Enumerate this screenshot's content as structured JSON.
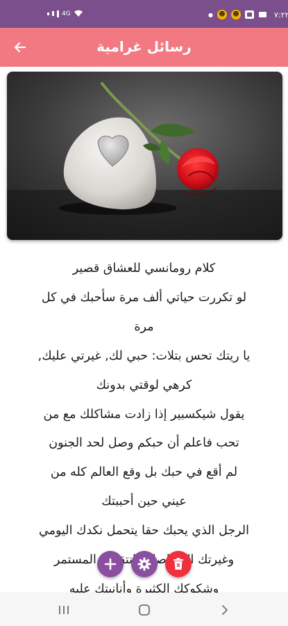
{
  "status_bar": {
    "time": "٧:٢٢",
    "network": "4G"
  },
  "app_bar": {
    "title": "رسائل غرامية",
    "back_icon": "arrow-back-icon"
  },
  "hero": {
    "image": "heart-stone-and-red-rose-photo"
  },
  "article": {
    "lines": [
      "كلام رومانسي للعشاق قصير",
      "لو تكررت حياتي ألف مرة سأحبك في كل",
      "مرة",
      "يا ريتك تحس بتلات: حبي لك, غيرتي عليك,",
      "كرهي لوقتي بدونك",
      "يقول شيكسبير إذا زادت مشاكلك مع من",
      "تحب فاعلم أن حبكم وصل لحد الجنون",
      "لم أقع في حبك بل وقع العالم كله من",
      "عيني حين أحببتك",
      "الرجل الذي يحبك حقا يتحمل نكدك اليومي",
      "وغيرتك المتواصلة وانتقادك المستمر",
      "وشكوكك الكثيرة وأنانيتك عليه"
    ]
  },
  "actions": {
    "add": "add-icon",
    "settings": "gear-icon",
    "delete": "trash-icon"
  },
  "nav": {
    "recents": "recents-icon",
    "home": "home-icon",
    "back": "chevron-back-icon"
  },
  "colors": {
    "status_bar": "#7a4f8c",
    "app_bar": "#f27981",
    "fab_purple": "#8a4fa0",
    "fab_red": "#ef2f3c"
  }
}
